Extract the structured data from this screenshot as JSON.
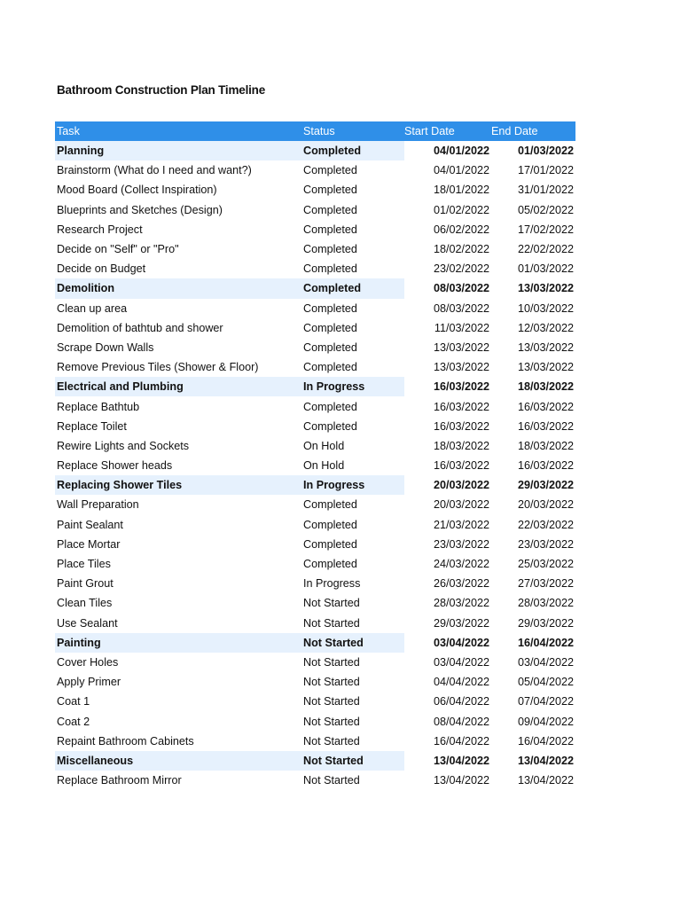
{
  "title": "Bathroom Construction Plan Timeline",
  "table": {
    "headers": [
      "Task",
      "Status",
      "Start Date",
      "End Date"
    ],
    "rows": [
      {
        "task": "Planning",
        "status": "Completed",
        "start": "04/01/2022",
        "end": "01/03/2022",
        "section": true
      },
      {
        "task": "Brainstorm (What do I need and want?)",
        "status": "Completed",
        "start": "04/01/2022",
        "end": "17/01/2022",
        "section": false
      },
      {
        "task": "Mood Board (Collect Inspiration)",
        "status": "Completed",
        "start": "18/01/2022",
        "end": "31/01/2022",
        "section": false
      },
      {
        "task": "Blueprints and Sketches (Design)",
        "status": "Completed",
        "start": "01/02/2022",
        "end": "05/02/2022",
        "section": false
      },
      {
        "task": "Research Project",
        "status": "Completed",
        "start": "06/02/2022",
        "end": "17/02/2022",
        "section": false
      },
      {
        "task": "Decide on \"Self\" or \"Pro\"",
        "status": "Completed",
        "start": "18/02/2022",
        "end": "22/02/2022",
        "section": false
      },
      {
        "task": "Decide on Budget",
        "status": "Completed",
        "start": "23/02/2022",
        "end": "01/03/2022",
        "section": false
      },
      {
        "task": "Demolition",
        "status": "Completed",
        "start": "08/03/2022",
        "end": "13/03/2022",
        "section": true
      },
      {
        "task": "Clean up area",
        "status": "Completed",
        "start": "08/03/2022",
        "end": "10/03/2022",
        "section": false
      },
      {
        "task": "Demolition of bathtub and shower",
        "status": "Completed",
        "start": "11/03/2022",
        "end": "12/03/2022",
        "section": false
      },
      {
        "task": "Scrape Down Walls",
        "status": "Completed",
        "start": "13/03/2022",
        "end": "13/03/2022",
        "section": false
      },
      {
        "task": "Remove Previous Tiles (Shower & Floor)",
        "status": "Completed",
        "start": "13/03/2022",
        "end": "13/03/2022",
        "section": false
      },
      {
        "task": "Electrical and Plumbing",
        "status": "In Progress",
        "start": "16/03/2022",
        "end": "18/03/2022",
        "section": true
      },
      {
        "task": "Replace Bathtub",
        "status": "Completed",
        "start": "16/03/2022",
        "end": "16/03/2022",
        "section": false
      },
      {
        "task": "Replace Toilet",
        "status": "Completed",
        "start": "16/03/2022",
        "end": "16/03/2022",
        "section": false
      },
      {
        "task": "Rewire Lights and Sockets",
        "status": "On Hold",
        "start": "18/03/2022",
        "end": "18/03/2022",
        "section": false
      },
      {
        "task": "Replace Shower heads",
        "status": "On Hold",
        "start": "16/03/2022",
        "end": "16/03/2022",
        "section": false
      },
      {
        "task": "Replacing Shower Tiles",
        "status": "In Progress",
        "start": "20/03/2022",
        "end": "29/03/2022",
        "section": true
      },
      {
        "task": "Wall Preparation",
        "status": "Completed",
        "start": "20/03/2022",
        "end": "20/03/2022",
        "section": false
      },
      {
        "task": "Paint Sealant",
        "status": "Completed",
        "start": "21/03/2022",
        "end": "22/03/2022",
        "section": false
      },
      {
        "task": "Place Mortar",
        "status": "Completed",
        "start": "23/03/2022",
        "end": "23/03/2022",
        "section": false
      },
      {
        "task": "Place Tiles",
        "status": "Completed",
        "start": "24/03/2022",
        "end": "25/03/2022",
        "section": false
      },
      {
        "task": "Paint Grout",
        "status": "In Progress",
        "start": "26/03/2022",
        "end": "27/03/2022",
        "section": false
      },
      {
        "task": "Clean Tiles",
        "status": "Not Started",
        "start": "28/03/2022",
        "end": "28/03/2022",
        "section": false
      },
      {
        "task": "Use Sealant",
        "status": "Not Started",
        "start": "29/03/2022",
        "end": "29/03/2022",
        "section": false
      },
      {
        "task": "Painting",
        "status": "Not Started",
        "start": "03/04/2022",
        "end": "16/04/2022",
        "section": true
      },
      {
        "task": "Cover Holes",
        "status": "Not Started",
        "start": "03/04/2022",
        "end": "03/04/2022",
        "section": false
      },
      {
        "task": "Apply Primer",
        "status": "Not Started",
        "start": "04/04/2022",
        "end": "05/04/2022",
        "section": false
      },
      {
        "task": "Coat 1",
        "status": "Not Started",
        "start": "06/04/2022",
        "end": "07/04/2022",
        "section": false
      },
      {
        "task": "Coat 2",
        "status": "Not Started",
        "start": "08/04/2022",
        "end": "09/04/2022",
        "section": false
      },
      {
        "task": "Repaint Bathroom Cabinets",
        "status": "Not Started",
        "start": "16/04/2022",
        "end": "16/04/2022",
        "section": false
      },
      {
        "task": "Miscellaneous",
        "status": "Not Started",
        "start": "13/04/2022",
        "end": "13/04/2022",
        "section": true
      },
      {
        "task": "Replace Bathroom Mirror",
        "status": "Not Started",
        "start": "13/04/2022",
        "end": "13/04/2022",
        "section": false
      }
    ]
  },
  "colors": {
    "header_bg": "#2f8fe8",
    "header_text": "#ffffff",
    "section_bg": "#e6f1fd"
  }
}
